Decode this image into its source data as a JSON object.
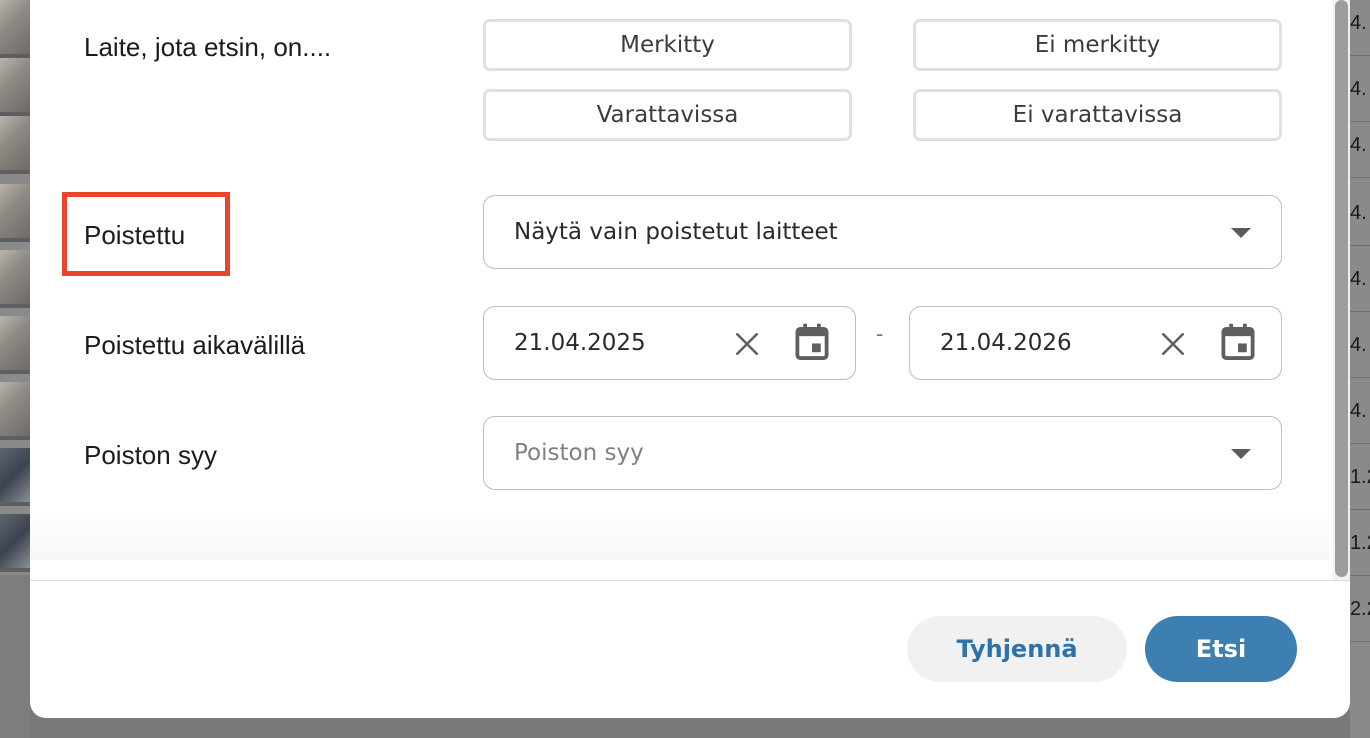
{
  "background": {
    "right_column_values": [
      "4.",
      "4.",
      "4.",
      "4.",
      "4.",
      "4.",
      "4.",
      "1.2",
      "1.2",
      "2.2"
    ]
  },
  "filters": {
    "device_state_label": "Laite, jota etsin, on....",
    "toggles": [
      "Merkitty",
      "Ei merkitty",
      "Varattavissa",
      "Ei varattavissa"
    ],
    "deleted_label": "Poistettu",
    "deleted_select_value": "Näytä vain poistetut laitteet",
    "deleted_range_label": "Poistettu aikavälillä",
    "date_from": "21.04.2025",
    "date_separator": "-",
    "date_to": "21.04.2026",
    "reason_label": "Poiston syy",
    "reason_placeholder": "Poiston syy"
  },
  "footer": {
    "clear_label": "Tyhjennä",
    "search_label": "Etsi"
  },
  "colors": {
    "highlight": "#e8452c",
    "primary": "#3d7fb0",
    "link": "#2d72a8"
  },
  "icons": [
    "clear-x-icon",
    "calendar-icon",
    "chevron-down-icon"
  ]
}
